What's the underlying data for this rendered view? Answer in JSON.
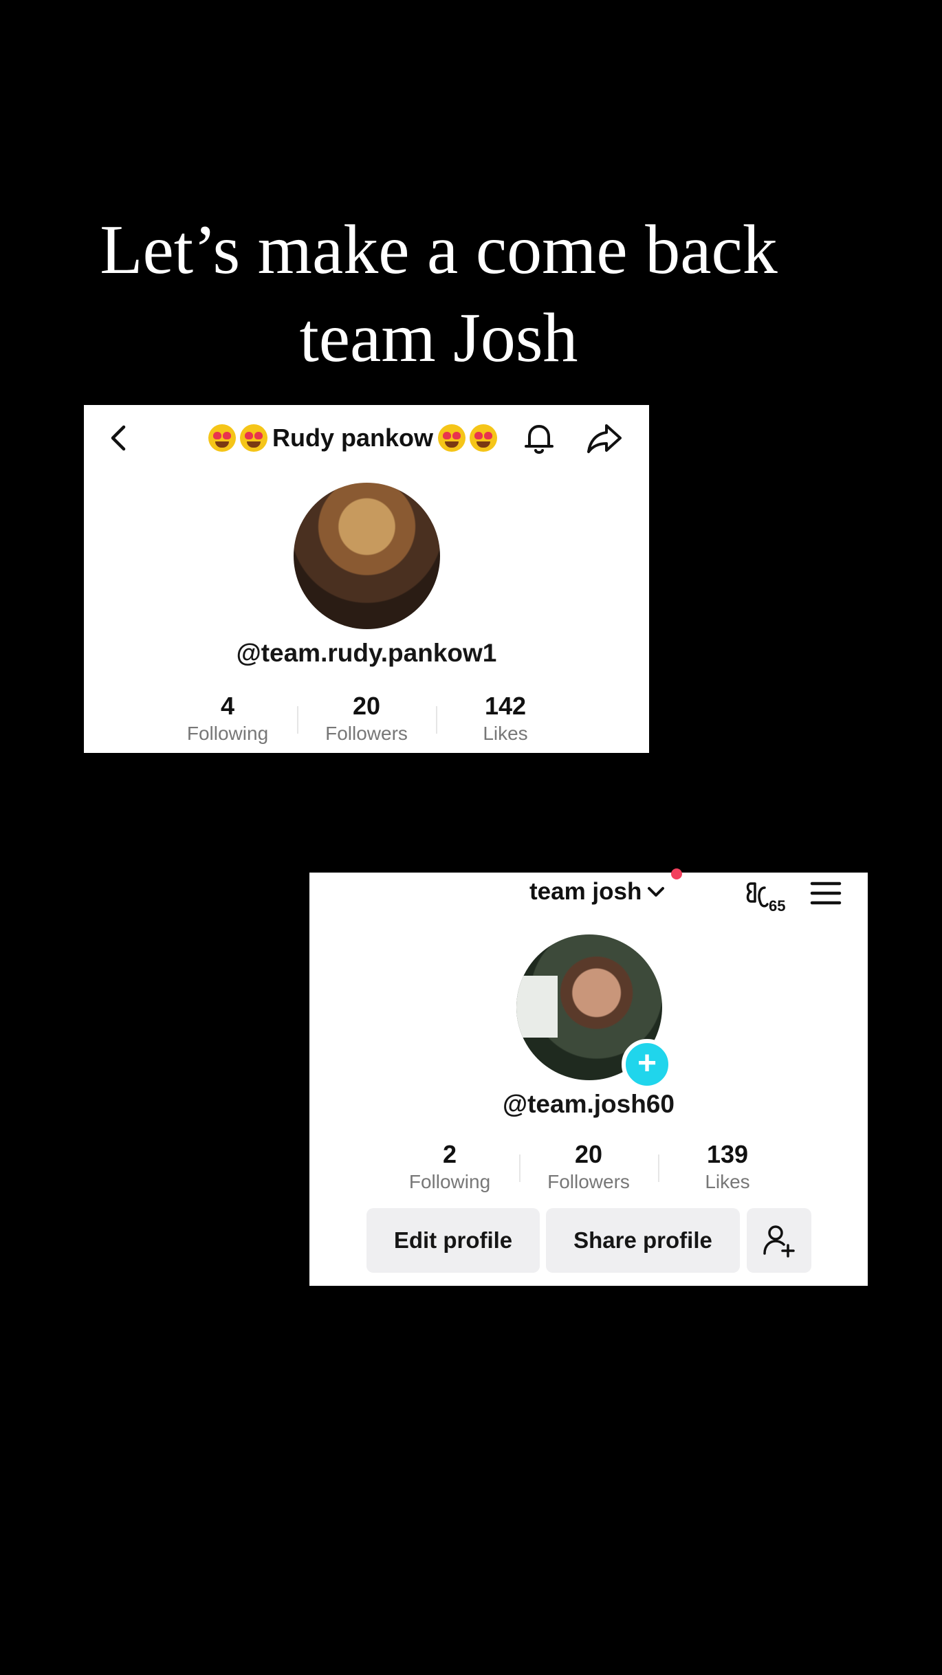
{
  "headline": {
    "line1": "Let’s make a come back",
    "line2": "team Josh"
  },
  "rudy_profile": {
    "title": "Rudy pankow",
    "handle": "@team.rudy.pankow1",
    "stats": [
      {
        "value": "4",
        "label": "Following"
      },
      {
        "value": "20",
        "label": "Followers"
      },
      {
        "value": "142",
        "label": "Likes"
      }
    ],
    "icons": {
      "back": "chevron-left-icon",
      "bell": "bell-icon",
      "share": "share-arrow-icon",
      "emoji": "heart-eyes-emoji-icon"
    }
  },
  "josh_profile": {
    "account_name": "team josh",
    "handle": "@team.josh60",
    "score_badge": "65",
    "stats": [
      {
        "value": "2",
        "label": "Following"
      },
      {
        "value": "20",
        "label": "Followers"
      },
      {
        "value": "139",
        "label": "Likes"
      }
    ],
    "buttons": {
      "edit": "Edit profile",
      "share": "Share profile"
    },
    "icons": {
      "dropdown": "chevron-down-icon",
      "menu": "hamburger-menu-icon",
      "add_friend": "add-user-icon",
      "plus": "plus-icon"
    },
    "colors": {
      "accent": "#20d5ec",
      "notification_dot": "#f2405d"
    }
  }
}
